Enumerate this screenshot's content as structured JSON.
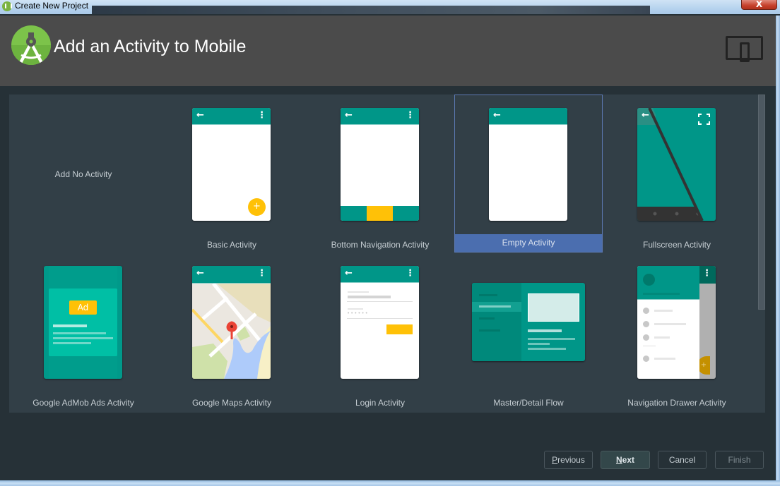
{
  "window": {
    "title": "Create New Project",
    "close_glyph": "X"
  },
  "header": {
    "title": "Add an Activity to Mobile",
    "logo_icon": "android-studio-logo",
    "device_icon": "form-factor-mobile-icon"
  },
  "colors": {
    "accent_teal": "#009688",
    "accent_yellow": "#FFC107",
    "selection": "#4B6EAF",
    "panel_bg": "#323F47",
    "header_bg": "#4B4B4B"
  },
  "activities": [
    {
      "label": "Add No Activity",
      "selected": false
    },
    {
      "label": "Basic Activity",
      "selected": false
    },
    {
      "label": "Bottom Navigation Activity",
      "selected": false
    },
    {
      "label": "Empty Activity",
      "selected": true
    },
    {
      "label": "Fullscreen Activity",
      "selected": false
    },
    {
      "label": "Google AdMob Ads Activity",
      "selected": false
    },
    {
      "label": "Google Maps Activity",
      "selected": false
    },
    {
      "label": "Login Activity",
      "selected": false
    },
    {
      "label": "Master/Detail Flow",
      "selected": false
    },
    {
      "label": "Navigation Drawer Activity",
      "selected": false
    }
  ],
  "admob": {
    "ad_label": "Ad"
  },
  "login": {
    "password_mask": "••••••"
  },
  "buttons": {
    "previous": {
      "label": "Previous",
      "mnemonic": "P",
      "rest": "revious",
      "enabled": true
    },
    "next": {
      "label": "Next",
      "mnemonic": "N",
      "rest": "ext",
      "enabled": true,
      "default": true
    },
    "cancel": {
      "label": "Cancel",
      "enabled": true
    },
    "finish": {
      "label": "Finish",
      "enabled": false
    }
  }
}
